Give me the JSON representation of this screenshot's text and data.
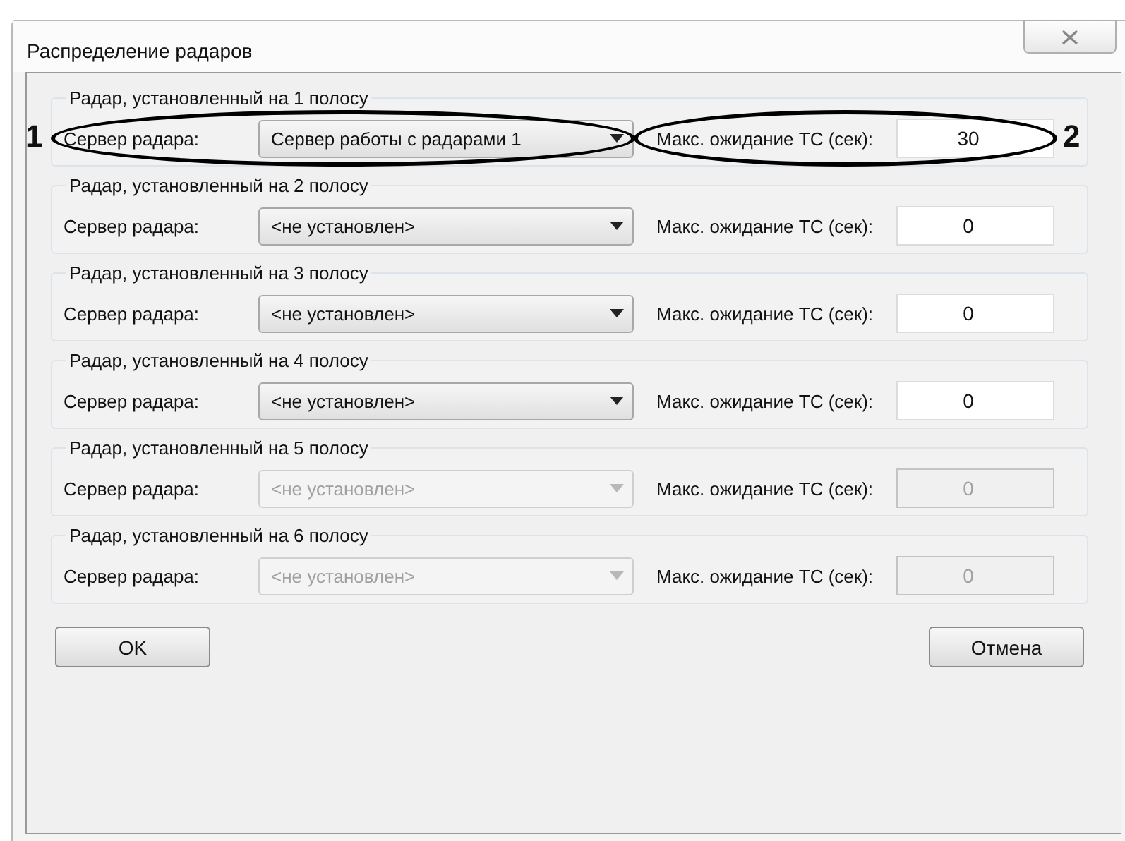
{
  "window": {
    "title": "Распределение радаров"
  },
  "lanes": [
    {
      "title": "Радар, установленный на 1 полосу",
      "server_label": "Сервер радара:",
      "server_value": "Сервер работы с радарами 1",
      "wait_label": "Макс. ожидание ТС (сек):",
      "wait_value": "30",
      "disabled": false
    },
    {
      "title": "Радар, установленный на 2 полосу",
      "server_label": "Сервер радара:",
      "server_value": "<не установлен>",
      "wait_label": "Макс. ожидание ТС (сек):",
      "wait_value": "0",
      "disabled": false
    },
    {
      "title": "Радар, установленный на 3 полосу",
      "server_label": "Сервер радара:",
      "server_value": "<не установлен>",
      "wait_label": "Макс. ожидание ТС (сек):",
      "wait_value": "0",
      "disabled": false
    },
    {
      "title": "Радар, установленный на 4 полосу",
      "server_label": "Сервер радара:",
      "server_value": "<не установлен>",
      "wait_label": "Макс. ожидание ТС (сек):",
      "wait_value": "0",
      "disabled": false
    },
    {
      "title": "Радар, установленный на 5 полосу",
      "server_label": "Сервер радара:",
      "server_value": "<не установлен>",
      "wait_label": "Макс. ожидание ТС (сек):",
      "wait_value": "0",
      "disabled": true
    },
    {
      "title": "Радар, установленный на 6 полосу",
      "server_label": "Сервер радара:",
      "server_value": "<не установлен>",
      "wait_label": "Макс. ожидание ТС (сек):",
      "wait_value": "0",
      "disabled": true
    }
  ],
  "callouts": [
    {
      "label": "1"
    },
    {
      "label": "2"
    }
  ],
  "buttons": [
    {
      "label": "OK"
    },
    {
      "label": "Отмена"
    }
  ]
}
